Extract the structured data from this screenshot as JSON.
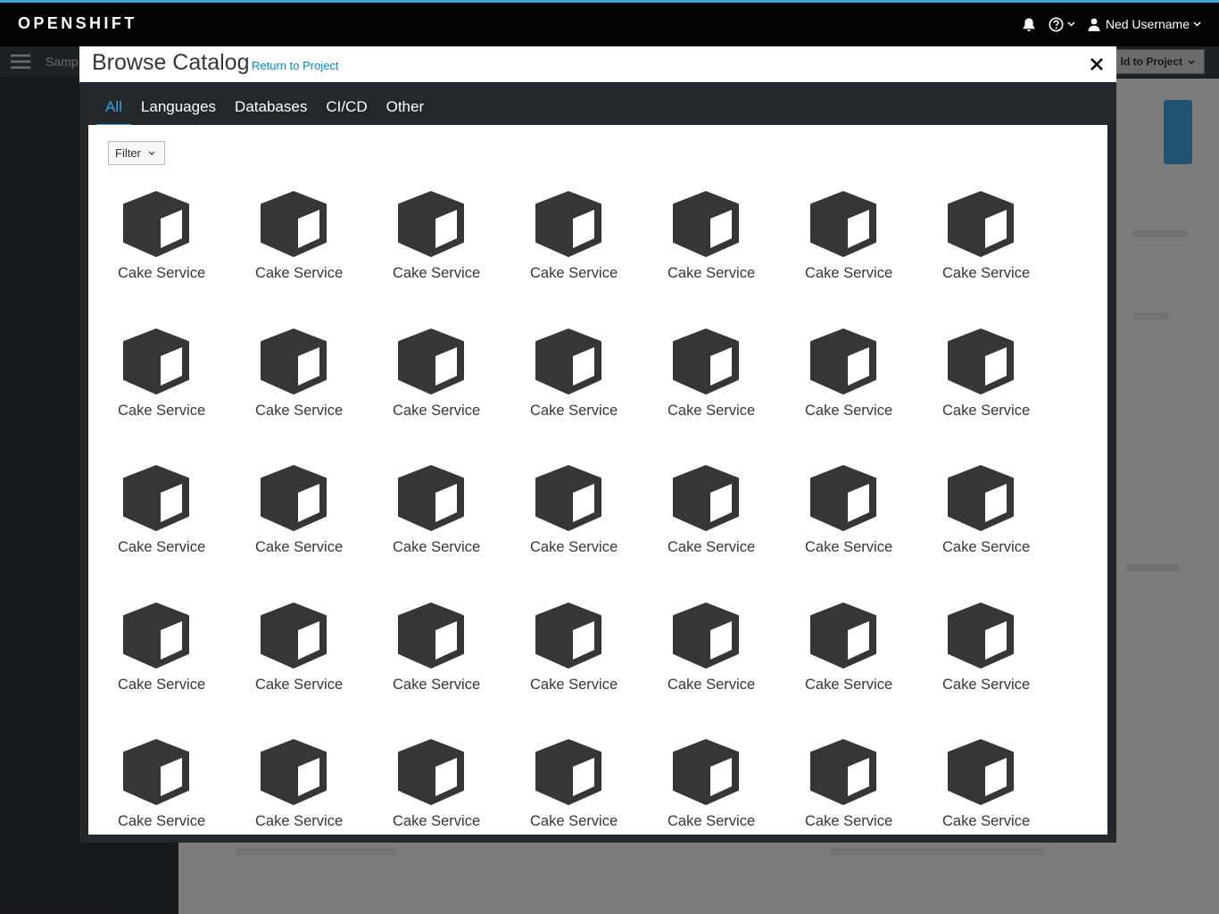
{
  "masthead": {
    "brand": "OPENSHIFT",
    "icons": [
      "bell-icon",
      "help-icon",
      "user-icon"
    ],
    "user_name": "Ned Username"
  },
  "subbar": {
    "project_name": "Samp",
    "add_button_label": "ld to Project"
  },
  "modal": {
    "title": "Browse Catalog",
    "return_link": "Return to Project",
    "close_icon": "close-icon",
    "tabs": [
      {
        "label": "All",
        "active": true
      },
      {
        "label": "Languages",
        "active": false
      },
      {
        "label": "Databases",
        "active": false
      },
      {
        "label": "CI/CD",
        "active": false
      },
      {
        "label": "Other",
        "active": false
      }
    ],
    "filter_label": "Filter",
    "item_icon": "cube-icon",
    "items": [
      "Cake Service",
      "Cake Service",
      "Cake Service",
      "Cake Service",
      "Cake Service",
      "Cake Service",
      "Cake Service",
      "Cake Service",
      "Cake Service",
      "Cake Service",
      "Cake Service",
      "Cake Service",
      "Cake Service",
      "Cake Service",
      "Cake Service",
      "Cake Service",
      "Cake Service",
      "Cake Service",
      "Cake Service",
      "Cake Service",
      "Cake Service",
      "Cake Service",
      "Cake Service",
      "Cake Service",
      "Cake Service",
      "Cake Service",
      "Cake Service",
      "Cake Service",
      "Cake Service",
      "Cake Service",
      "Cake Service",
      "Cake Service",
      "Cake Service",
      "Cake Service",
      "Cake Service"
    ]
  },
  "colors": {
    "accent": "#39a5dc",
    "link": "#0088ce",
    "masthead": "#030303",
    "modal_frame": "#21272b"
  }
}
